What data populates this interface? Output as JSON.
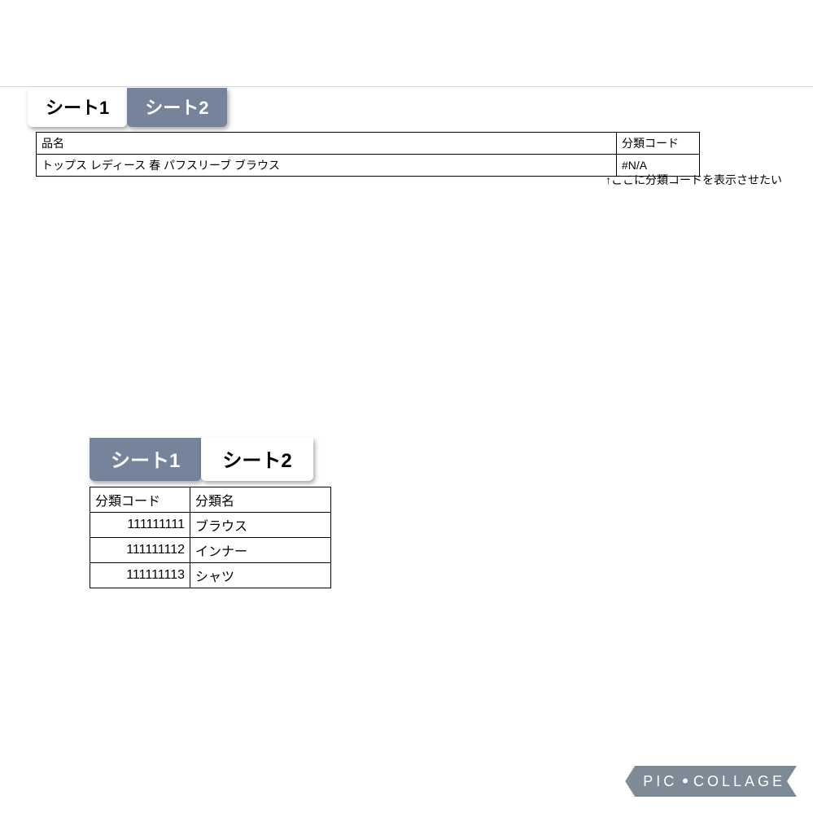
{
  "upper": {
    "tabs": [
      {
        "label": "シート1",
        "active": true
      },
      {
        "label": "シート2",
        "active": false
      }
    ],
    "table": {
      "headers": {
        "col1": "品名",
        "col2": "分類コード"
      },
      "row": {
        "name": "トップス レディース 春 パフスリーブ ブラウス",
        "code": "#N/A"
      }
    },
    "annotation": "↑ここに分類コードを表示させたい"
  },
  "lower": {
    "tabs": [
      {
        "label": "シート1",
        "active": false
      },
      {
        "label": "シート2",
        "active": true
      }
    ],
    "table": {
      "headers": {
        "code": "分類コード",
        "name": "分類名"
      },
      "rows": [
        {
          "code": "111111111",
          "name": "ブラウス"
        },
        {
          "code": "111111112",
          "name": "インナー"
        },
        {
          "code": "111111113",
          "name": "シャツ"
        }
      ]
    }
  },
  "watermark": {
    "left": "PIC",
    "dot": "•",
    "right": "COLLAGE"
  }
}
